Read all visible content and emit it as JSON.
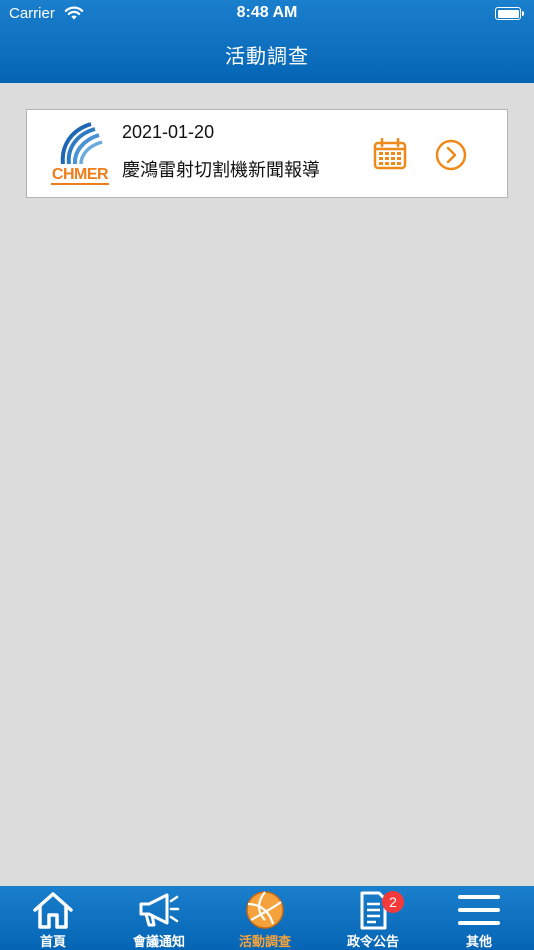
{
  "status_bar": {
    "carrier": "Carrier",
    "time": "8:48 AM"
  },
  "nav": {
    "title": "活動調查"
  },
  "items": [
    {
      "logo_text": "CHMER",
      "date": "2021-01-20",
      "title": "慶鴻雷射切割機新聞報導"
    }
  ],
  "tabs": [
    {
      "label": "首頁",
      "icon": "home-icon",
      "active": false
    },
    {
      "label": "會議通知",
      "icon": "megaphone-icon",
      "active": false
    },
    {
      "label": "活動調查",
      "icon": "volleyball-icon",
      "active": true
    },
    {
      "label": "政令公告",
      "icon": "document-icon",
      "active": false,
      "badge": "2"
    },
    {
      "label": "其他",
      "icon": "menu-icon",
      "active": false
    }
  ],
  "colors": {
    "brand_blue": "#0a6fc2",
    "accent_orange": "#ef8a1a",
    "badge_red": "#f43a3a",
    "background": "#dcdcdc"
  }
}
